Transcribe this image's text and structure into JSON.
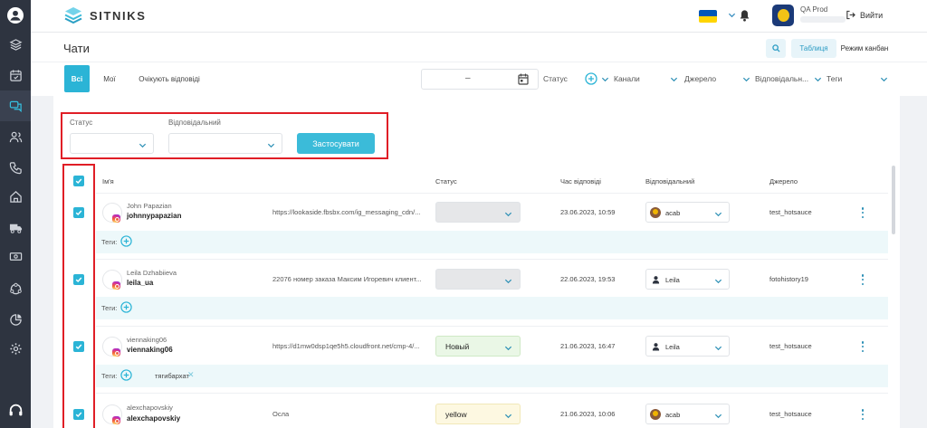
{
  "app": {
    "brand": "SITNIKS",
    "user_name": "QA Prod",
    "logout_label": "Вийти"
  },
  "page": {
    "title": "Чати",
    "view_table": "Таблиця",
    "view_kanban": "Режим канбан"
  },
  "tabs": [
    {
      "label": "Всі"
    },
    {
      "label": "Мої"
    },
    {
      "label": "Очікують відповіді"
    }
  ],
  "filters": {
    "date_separator": "–",
    "status_label": "Статус",
    "channels_label": "Канали",
    "source_label": "Джерело",
    "responsible_label": "Відповідальн...",
    "tags_label": "Теги"
  },
  "filter_panel": {
    "status_label": "Статус",
    "responsible_label": "Відповідальний",
    "apply_label": "Застосувати"
  },
  "table": {
    "headers": {
      "name": "Ім'я",
      "status": "Статус",
      "time": "Час відповіді",
      "responsible": "Відповідальний",
      "source": "Джерело"
    },
    "tags_label": "Теги:",
    "rows": [
      {
        "name": "John Papazian",
        "username": "johnnypapazian",
        "message": "https://lookaside.fbsbx.com/ig_messaging_cdn/...",
        "status": "",
        "time": "23.06.2023, 10:59",
        "responsible": "acab",
        "source": "test_hotsauce",
        "tag": ""
      },
      {
        "name": "Leila Dzhabiieva",
        "username": "leila_ua",
        "message": "22076 номер заказа Максим Игоревич клиент...",
        "status": "",
        "time": "22.06.2023, 19:53",
        "responsible": "Leila",
        "source": "fotohistory19",
        "tag": ""
      },
      {
        "name": "viennaking06",
        "username": "viennaking06",
        "message": "https://d1mw0dsp1qe5h5.cloudfront.net/cmp-4/...",
        "status": "Новый",
        "time": "21.06.2023, 16:47",
        "responsible": "Leila",
        "source": "test_hotsauce",
        "tag": "тягибархат"
      },
      {
        "name": "alexchapovskiy",
        "username": "alexchapovskiy",
        "message": "Осла",
        "status": "yellow",
        "time": "21.06.2023, 10:06",
        "responsible": "acab",
        "source": "test_hotsauce",
        "tag": ""
      }
    ]
  },
  "colors": {
    "sidebar": "#2e3440",
    "accent": "#2bb4d6",
    "highlight_border": "#e01e26",
    "status_new_bg": "#eaf7e6",
    "status_yellow_bg": "#fdf8e1",
    "status_empty_bg": "#e6e7e9"
  },
  "icons": {
    "sidebar": [
      "user-icon",
      "layers-icon",
      "calendar-icon",
      "chat-icon",
      "users-icon",
      "phone-icon",
      "home-icon",
      "truck-icon",
      "money-icon",
      "network-icon",
      "pie-chart-icon",
      "settings-icon",
      "headset-icon"
    ],
    "topbar": [
      "flag-ua-icon",
      "bell-icon",
      "logout-icon"
    ]
  }
}
